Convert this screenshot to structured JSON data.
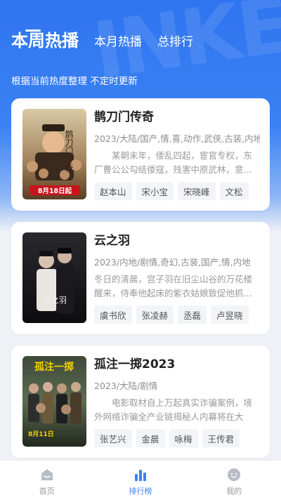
{
  "header": {
    "tabs": [
      {
        "label": "本周热播",
        "active": true
      },
      {
        "label": "本月热播",
        "active": false
      },
      {
        "label": "总排行",
        "active": false
      }
    ],
    "subtitle": "根据当前热度整理 不定时更新",
    "accent_color": "#3b82f4"
  },
  "items": [
    {
      "title": "鹊刀门传奇",
      "meta": "2023/大陆/国产,情,喜,动作,武侠,古装,内地",
      "desc": "某朝末年，倭乱四起，宦官专权，东厂曹公公勾结倭寇，残害中原武林，意…",
      "actors": [
        "赵本山",
        "宋小宝",
        "宋晓峰",
        "文松"
      ],
      "poster": {
        "release": "8月18日起",
        "calligraphy": "鹊刀门传奇",
        "icon": "poster-image"
      }
    },
    {
      "title": "云之羽",
      "meta": "2023/内地/剧情,奇幻,古装,国产,情,内地",
      "desc": "冬日的清晨，宫子羽在旧尘山谷的万花楼醒来，侍奉他起床的紫衣姑娘致促他抓…",
      "actors": [
        "虞书欣",
        "张凌赫",
        "丞磊",
        "卢昱晓"
      ],
      "poster": {
        "calligraphy": "云之羽",
        "icon": "poster-image"
      }
    },
    {
      "title": "孤注一掷2023",
      "meta": "2023/大陆/剧情",
      "desc": "电影取材自上万起真实诈骗案例，境外网络诈骗全产业链揭秘人内幕将在大银…",
      "actors": [
        "张艺兴",
        "金晨",
        "咏梅",
        "王传君"
      ],
      "poster": {
        "release": "8月11日",
        "calligraphy": "孤注一掷",
        "icon": "poster-image"
      }
    }
  ],
  "nav": [
    {
      "label": "首页",
      "icon": "home-icon",
      "active": false
    },
    {
      "label": "排行榜",
      "icon": "chart-icon",
      "active": true
    },
    {
      "label": "我的",
      "icon": "profile-icon",
      "active": false
    }
  ]
}
